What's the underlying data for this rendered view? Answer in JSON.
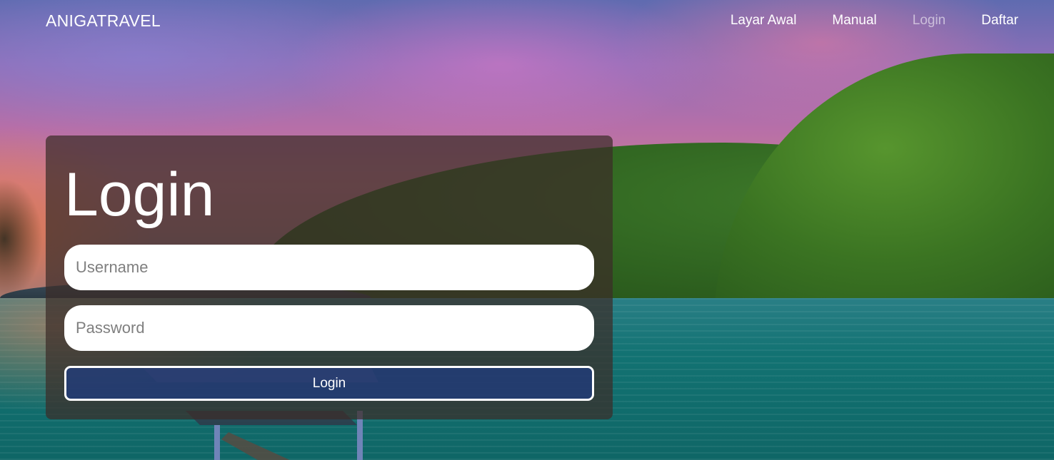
{
  "navbar": {
    "brand": "ANIGATRAVEL",
    "links": [
      {
        "label": "Layar Awal"
      },
      {
        "label": "Manual"
      },
      {
        "label": "Login",
        "active": true
      },
      {
        "label": "Daftar"
      }
    ]
  },
  "login": {
    "title": "Login",
    "username_placeholder": "Username",
    "username_value": "",
    "password_placeholder": "Password",
    "password_value": "",
    "button_label": "Login"
  },
  "colors": {
    "card_bg": "#3c2d28",
    "button_bg": "#1e3c82",
    "active_link": "#ffffff8c"
  }
}
